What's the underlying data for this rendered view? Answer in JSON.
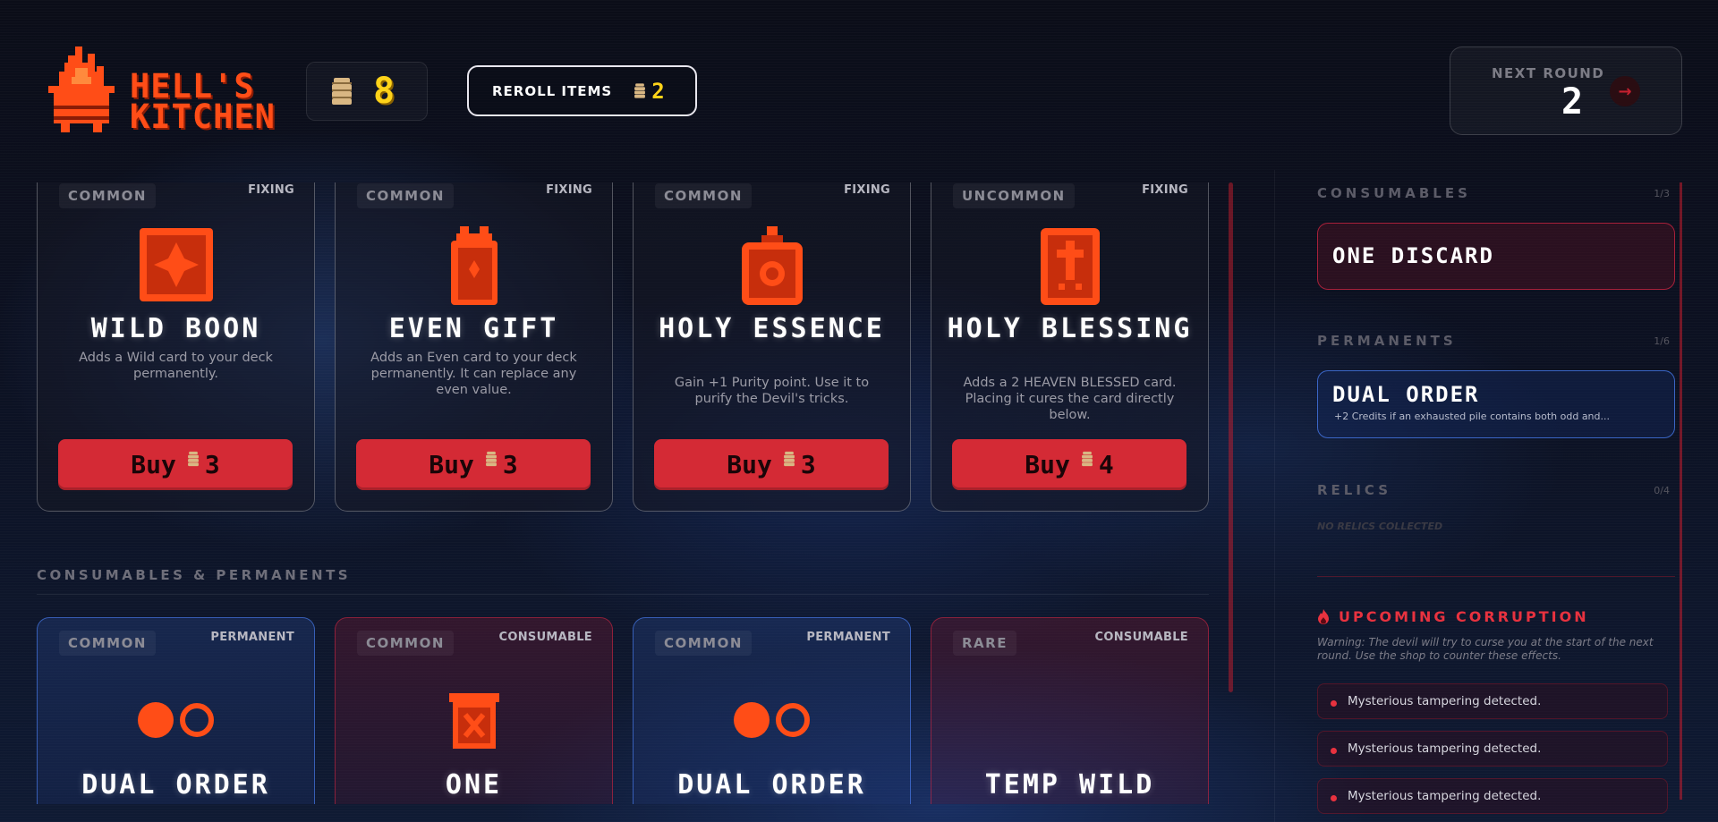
{
  "header": {
    "logo_line1": "HELL'S",
    "logo_line2": "KITCHEN",
    "coins": "8",
    "reroll": {
      "label": "REROLL ITEMS",
      "cost": "2"
    },
    "next_round": {
      "label": "NEXT ROUND",
      "value": "2",
      "arrow": "→"
    }
  },
  "colors": {
    "accent_red": "#d42a35",
    "coin_yellow": "#ffd319",
    "logo_orange": "#ff4d17",
    "permanent_blue": "#4678e6"
  },
  "fixing_cards": [
    {
      "rarity": "COMMON",
      "kind": "FIXING",
      "icon": "wild-card-icon",
      "title": "WILD BOON",
      "desc": "Adds a Wild card to your deck permanently.",
      "buy": "Buy",
      "price": "3"
    },
    {
      "rarity": "COMMON",
      "kind": "FIXING",
      "icon": "gift-card-icon",
      "title": "EVEN GIFT",
      "desc": "Adds an Even card to your deck permanently. It can replace any even value.",
      "buy": "Buy",
      "price": "3"
    },
    {
      "rarity": "COMMON",
      "kind": "FIXING",
      "icon": "holy-flask-icon",
      "title": "HOLY ESSENCE",
      "desc": "Gain +1 Purity point. Use it to purify the Devil's tricks.",
      "buy": "Buy",
      "price": "3"
    },
    {
      "rarity": "UNCOMMON",
      "kind": "FIXING",
      "icon": "cross-card-icon",
      "title": "HOLY BLESSING",
      "desc": "Adds a 2 HEAVEN BLESSED card. Placing it cures the card directly below.",
      "buy": "Buy",
      "price": "4"
    }
  ],
  "section_title": "CONSUMABLES & PERMANENTS",
  "item_cards": [
    {
      "rarity": "COMMON",
      "kind": "PERMANENT",
      "icon": "odd-even-icon",
      "title": "DUAL ORDER",
      "style": "blue"
    },
    {
      "rarity": "COMMON",
      "kind": "CONSUMABLE",
      "icon": "trash-can-icon",
      "title": "ONE",
      "style": "red"
    },
    {
      "rarity": "COMMON",
      "kind": "PERMANENT",
      "icon": "odd-even-icon",
      "title": "DUAL ORDER",
      "style": "blue"
    },
    {
      "rarity": "RARE",
      "kind": "CONSUMABLE",
      "icon": "wild-card-icon",
      "title": "TEMP WILD",
      "style": "red"
    }
  ],
  "sidebar": {
    "consumables": {
      "title": "CONSUMABLES",
      "count": "1/3",
      "items": [
        {
          "name": "ONE DISCARD"
        }
      ]
    },
    "permanents": {
      "title": "PERMANENTS",
      "count": "1/6",
      "items": [
        {
          "name": "DUAL ORDER",
          "desc": "+2 Credits if an exhausted pile contains both odd and..."
        }
      ]
    },
    "relics": {
      "title": "RELICS",
      "count": "0/4",
      "empty": "NO RELICS COLLECTED"
    },
    "corruption": {
      "title": "UPCOMING CORRUPTION",
      "warning": "Warning: The devil will try to curse you at the start of the next round. Use the shop to counter these effects.",
      "items": [
        "Mysterious tampering detected.",
        "Mysterious tampering detected.",
        "Mysterious tampering detected."
      ]
    }
  }
}
